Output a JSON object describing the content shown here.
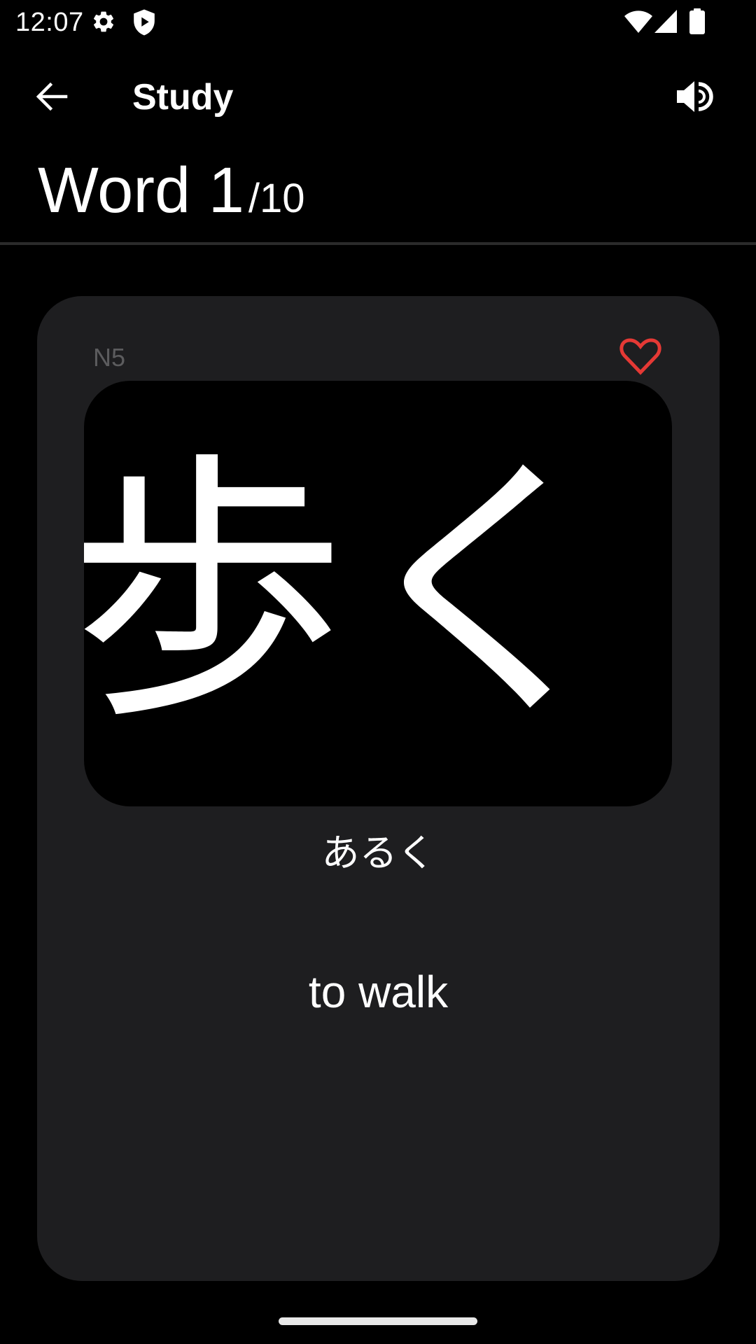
{
  "status_bar": {
    "time": "12:07",
    "left_icons": [
      "gear-icon",
      "shield-play-icon"
    ],
    "right_icons": [
      "wifi-icon",
      "cell-signal-icon",
      "battery-icon"
    ]
  },
  "toolbar": {
    "back_icon": "arrow-back-icon",
    "title": "Study",
    "audio_icon": "volume-up-icon"
  },
  "progress": {
    "label": "Word 1",
    "total": "/10",
    "current_index": 1,
    "total_count": 10
  },
  "card": {
    "level": "N5",
    "favorite_icon": "heart-outline-icon",
    "favorited": false,
    "kanji": "歩く",
    "reading": "あるく",
    "meaning": "to walk"
  },
  "colors": {
    "background": "#000000",
    "card": "#1e1e20",
    "favorite": "#e53935",
    "level_text": "#5c5c5e",
    "divider": "#2b2b2b"
  }
}
